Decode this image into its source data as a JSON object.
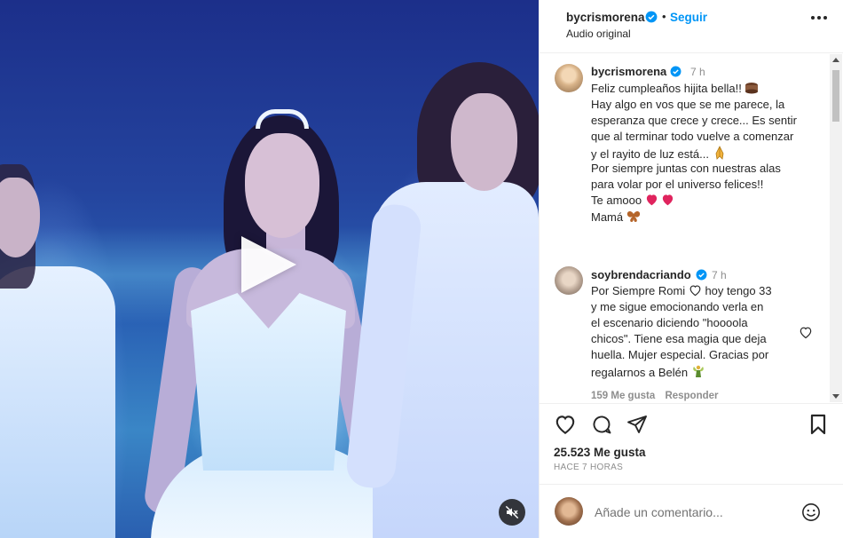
{
  "header": {
    "username": "bycrismorena",
    "separator": "•",
    "follow_label": "Seguir",
    "audio_label": "Audio original"
  },
  "media": {
    "play_icon": "play-icon",
    "mute_icon": "muted-speaker-icon",
    "state": "paused"
  },
  "caption": {
    "username": "bycrismorena",
    "time": "7 h",
    "lines": [
      "Feliz cumpleaños hijita bella!!",
      "Hay algo en vos que se me parece, la",
      "esperanza que crece y crece... Es sentir",
      "que al terminar todo vuelve a comenzar",
      "y el rayito de luz está...",
      "Por siempre juntas con nuestras alas",
      "para volar por el universo felices!!",
      "Te amooo",
      "Mamá"
    ]
  },
  "comment": {
    "username": "soybrendacriando",
    "time": "7 h",
    "lines": [
      "Por Siempre Romi",
      "hoy tengo 33",
      "y me sigue emocionando verla en",
      "el escenario diciendo \"hoooola",
      "chicos\". Tiene esa magia que deja",
      "huella. Mujer especial. Gracias por",
      "regalarnos a Belén"
    ],
    "likes": "159 Me gusta",
    "reply_label": "Responder"
  },
  "actions": {
    "likes_text": "25.523 Me gusta",
    "time_ago": "HACE 7 HORAS"
  },
  "add_comment": {
    "placeholder": "Añade un comentario..."
  },
  "colors": {
    "accent": "#0095f6",
    "text": "#262626",
    "muted": "#8e8e8e",
    "heart_red": "#e0245e"
  }
}
